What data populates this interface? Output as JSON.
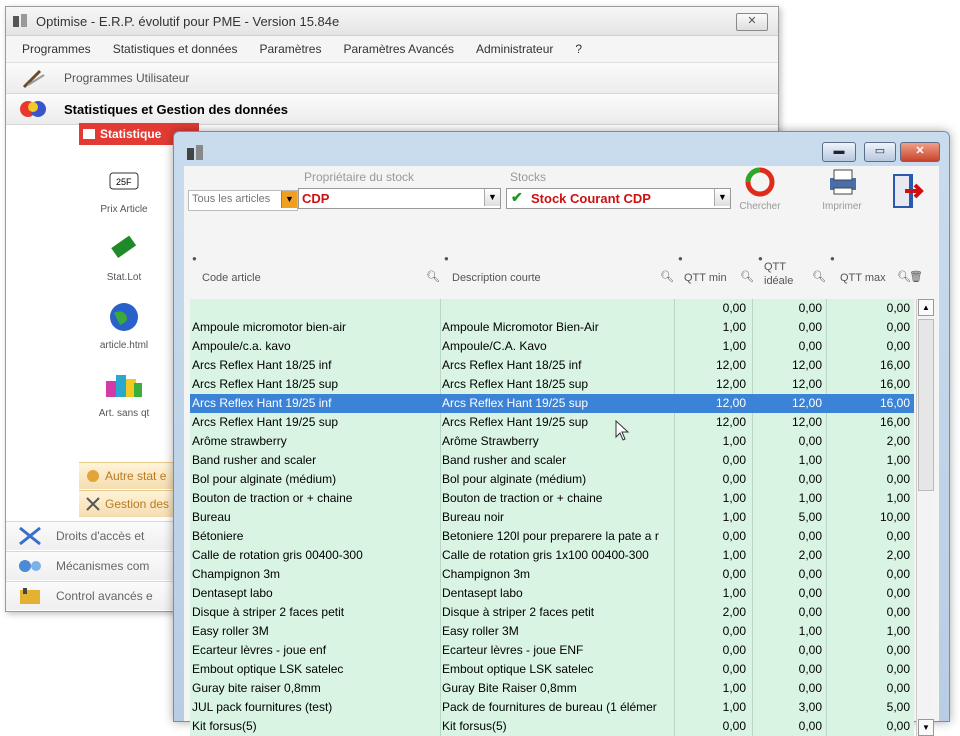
{
  "main_window": {
    "title": "Optimise  -  E.R.P. évolutif pour PME  -  Version 15.84e",
    "menu": [
      "Programmes",
      "Statistiques et données",
      "Paramètres",
      "Paramètres Avancés",
      "Administrateur",
      "?"
    ],
    "section_user": "Programmes Utilisateur",
    "section_stats": "Statistiques et Gestion des données",
    "sub_tab": "Statistique",
    "launchers": [
      "Prix Article",
      "Stat.Lot",
      "article.html",
      "Art. sans qt"
    ],
    "side_buttons": [
      "Autre stat e",
      "Gestion des"
    ],
    "bottom_sections": [
      "Droits d'accès et",
      "Mécanismes com",
      "Control avancés e"
    ]
  },
  "stock_window": {
    "filter_label": "Tous les articles",
    "owner_label": "Propriétaire du stock",
    "owner_value": "CDP",
    "stock_label": "Stocks",
    "stock_value": "Stock Courant CDP",
    "search_button": "Chercher",
    "print_button": "Imprimer",
    "columns": {
      "code": "Code article",
      "desc": "Description courte",
      "qmin": "QTT min",
      "qideal": "QTT idéale",
      "qmax": "QTT max"
    },
    "rows": [
      {
        "code": "",
        "desc": "",
        "qmin": "0,00",
        "qideal": "0,00",
        "qmax": "0,00"
      },
      {
        "code": "Ampoule micromotor bien-air",
        "desc": "Ampoule Micromotor Bien-Air",
        "qmin": "1,00",
        "qideal": "0,00",
        "qmax": "0,00"
      },
      {
        "code": "Ampoule/c.a. kavo",
        "desc": "Ampoule/C.A. Kavo",
        "qmin": "1,00",
        "qideal": "0,00",
        "qmax": "0,00"
      },
      {
        "code": "Arcs Reflex Hant 18/25 inf",
        "desc": "Arcs Reflex Hant 18/25 inf",
        "qmin": "12,00",
        "qideal": "12,00",
        "qmax": "16,00"
      },
      {
        "code": "Arcs Reflex Hant 18/25 sup",
        "desc": "Arcs Reflex Hant 18/25 sup",
        "qmin": "12,00",
        "qideal": "12,00",
        "qmax": "16,00"
      },
      {
        "code": "Arcs Reflex Hant 19/25 inf",
        "desc": "Arcs Reflex Hant 19/25 sup",
        "qmin": "12,00",
        "qideal": "12,00",
        "qmax": "16,00"
      },
      {
        "code": "Arcs Reflex Hant 19/25 sup",
        "desc": "Arcs Reflex Hant 19/25 sup",
        "qmin": "12,00",
        "qideal": "12,00",
        "qmax": "16,00"
      },
      {
        "code": "Arôme strawberry",
        "desc": "Arôme Strawberry",
        "qmin": "1,00",
        "qideal": "0,00",
        "qmax": "2,00"
      },
      {
        "code": "Band rusher and scaler",
        "desc": "Band rusher and scaler",
        "qmin": "0,00",
        "qideal": "1,00",
        "qmax": "1,00"
      },
      {
        "code": "Bol pour alginate (médium)",
        "desc": "Bol pour alginate (médium)",
        "qmin": "0,00",
        "qideal": "0,00",
        "qmax": "0,00"
      },
      {
        "code": "Bouton de traction or + chaine",
        "desc": "Bouton de traction or + chaine",
        "qmin": "1,00",
        "qideal": "1,00",
        "qmax": "1,00"
      },
      {
        "code": "Bureau",
        "desc": "Bureau noir",
        "qmin": "1,00",
        "qideal": "5,00",
        "qmax": "10,00"
      },
      {
        "code": "Bétoniere",
        "desc": "Betoniere 120l pour preparere la pate a r",
        "qmin": "0,00",
        "qideal": "0,00",
        "qmax": "0,00"
      },
      {
        "code": "Calle de rotation gris  00400-300",
        "desc": "Calle de rotation gris 1x100  00400-300",
        "qmin": "1,00",
        "qideal": "2,00",
        "qmax": "2,00"
      },
      {
        "code": "Champignon 3m",
        "desc": "Champignon 3m",
        "qmin": "0,00",
        "qideal": "0,00",
        "qmax": "0,00"
      },
      {
        "code": "Dentasept labo",
        "desc": "Dentasept labo",
        "qmin": "1,00",
        "qideal": "0,00",
        "qmax": "0,00"
      },
      {
        "code": "Disque à striper 2 faces petit",
        "desc": "Disque à striper 2 faces petit",
        "qmin": "2,00",
        "qideal": "0,00",
        "qmax": "0,00"
      },
      {
        "code": "Easy roller 3M",
        "desc": "Easy roller 3M",
        "qmin": "0,00",
        "qideal": "1,00",
        "qmax": "1,00"
      },
      {
        "code": "Ecarteur  lèvres  -  joue enf",
        "desc": "Ecarteur  lèvres  -  joue ENF",
        "qmin": "0,00",
        "qideal": "0,00",
        "qmax": "0,00"
      },
      {
        "code": "Embout optique LSK satelec",
        "desc": "Embout optique LSK satelec",
        "qmin": "0,00",
        "qideal": "0,00",
        "qmax": "0,00"
      },
      {
        "code": "Guray bite raiser 0,8mm",
        "desc": "Guray Bite Raiser 0,8mm",
        "qmin": "1,00",
        "qideal": "0,00",
        "qmax": "0,00"
      },
      {
        "code": "JUL pack fournitures (test)",
        "desc": "Pack de fournitures de bureau (1 élémer",
        "qmin": "1,00",
        "qideal": "3,00",
        "qmax": "5,00"
      },
      {
        "code": "Kit forsus(5)",
        "desc": "Kit forsus(5)",
        "qmin": "0,00",
        "qideal": "0,00",
        "qmax": "0,00"
      }
    ],
    "selected_row": 5,
    "colors": {
      "grid_bg": "#d9f4e3",
      "selection": "#3b83d6",
      "red_text": "#d01010"
    }
  }
}
